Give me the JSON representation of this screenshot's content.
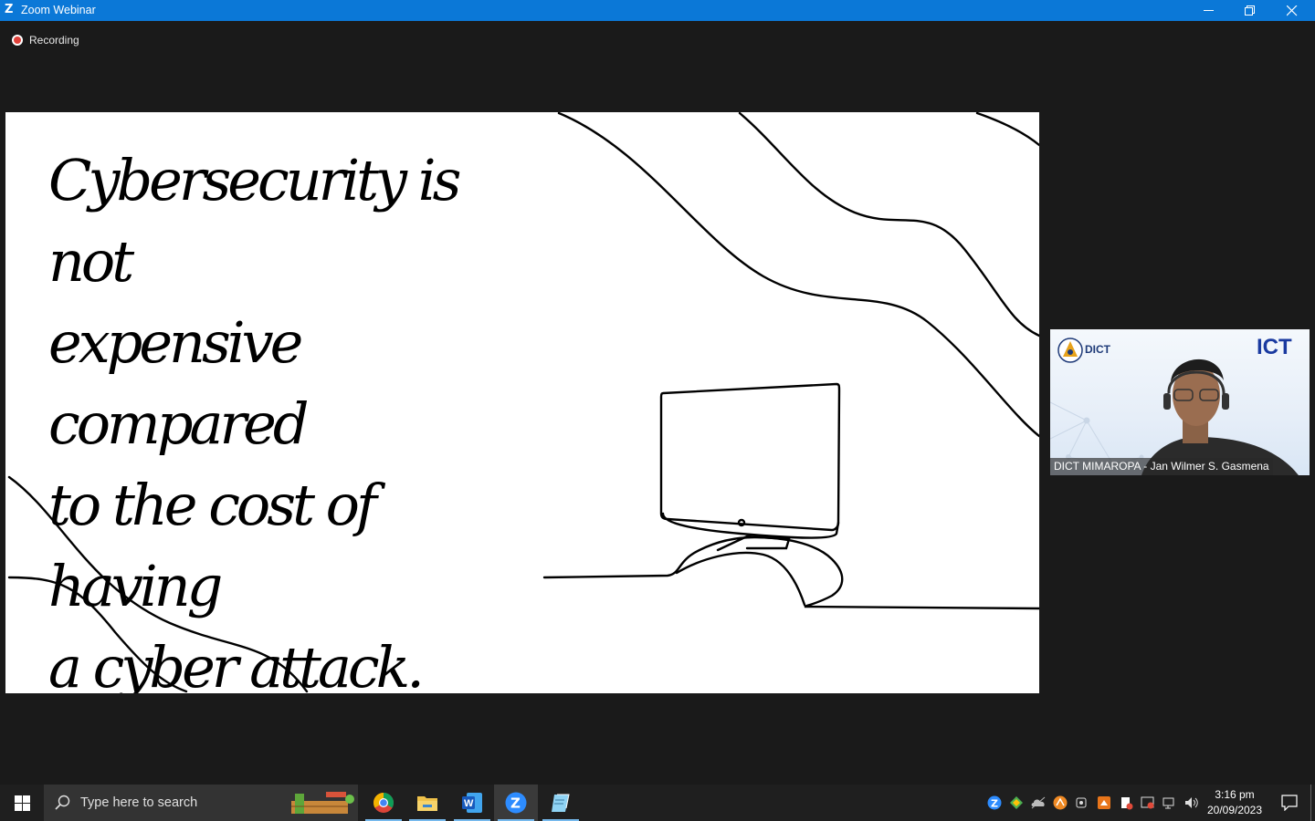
{
  "window": {
    "title": "Zoom Webinar",
    "logo_letter": "Z"
  },
  "recording": {
    "label": "Recording"
  },
  "slide": {
    "lines": [
      "Cybersecurity is not",
      "expensive compared",
      "to the cost of having",
      "a cyber attack."
    ]
  },
  "video": {
    "participant_name": "DICT MIMAROPA - Jan Wilmer S. Gasmena",
    "logo_left_text": "DICT",
    "logo_right_text": "ICT"
  },
  "taskbar": {
    "search_placeholder": "Type here to search",
    "apps": [
      "chrome",
      "file-explorer",
      "word",
      "zoom",
      "notepad"
    ],
    "time": "3:16 pm",
    "date": "20/09/2023"
  },
  "colors": {
    "titlebar": "#0b78d7",
    "recording_dot": "#e0413a",
    "taskbar": "#1f1f1f"
  }
}
